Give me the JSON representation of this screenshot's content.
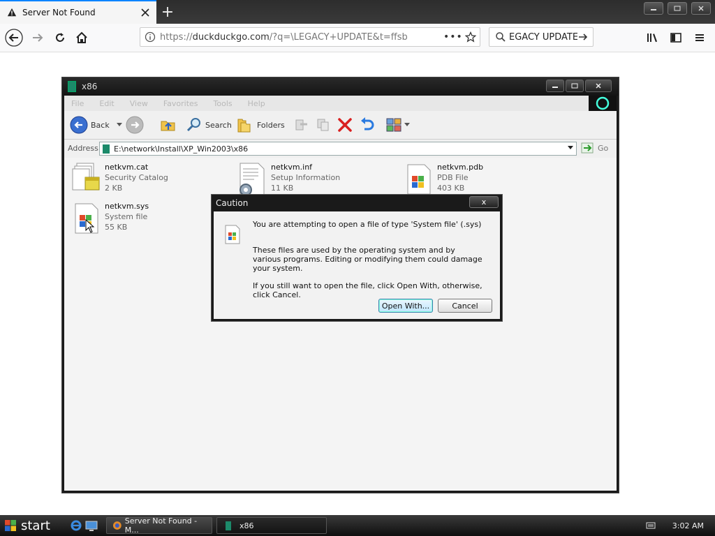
{
  "browser": {
    "tab_title": "Server Not Found",
    "url_prefix": "https://",
    "url_host": "duckduckgo.com",
    "url_rest": "/?q=\\LEGACY+UPDATE&t=ffsb",
    "url_more": "•••",
    "search_value": "EGACY UPDATE",
    "new_tab": "+"
  },
  "explorer": {
    "title": "x86",
    "menu": [
      "File",
      "Edit",
      "View",
      "Favorites",
      "Tools",
      "Help"
    ],
    "toolbar": {
      "back": "Back",
      "search": "Search",
      "folders": "Folders"
    },
    "address_label": "Address",
    "address_value": "E:\\network\\Install\\XP_Win2003\\x86",
    "go_label": "Go",
    "files": [
      {
        "name": "netkvm.cat",
        "type": "Security Catalog",
        "size": "2 KB"
      },
      {
        "name": "netkvm.inf",
        "type": "Setup Information",
        "size": "11 KB"
      },
      {
        "name": "netkvm.pdb",
        "type": "PDB File",
        "size": "403 KB"
      },
      {
        "name": "netkvm.sys",
        "type": "System file",
        "size": "55 KB"
      }
    ]
  },
  "dialog": {
    "title": "Caution",
    "close": "x",
    "line1": "You are attempting to open a file of type 'System file' (.sys)",
    "line2": "These files are used by the operating system and by various programs. Editing or modifying them could damage your system.",
    "line3": "If you still want to open the file, click Open With, otherwise, click Cancel.",
    "open_with": "Open With...",
    "cancel": "Cancel"
  },
  "taskbar": {
    "start": "start",
    "tasks": [
      "Server Not Found - M...",
      "x86"
    ],
    "clock": "3:02 AM"
  }
}
